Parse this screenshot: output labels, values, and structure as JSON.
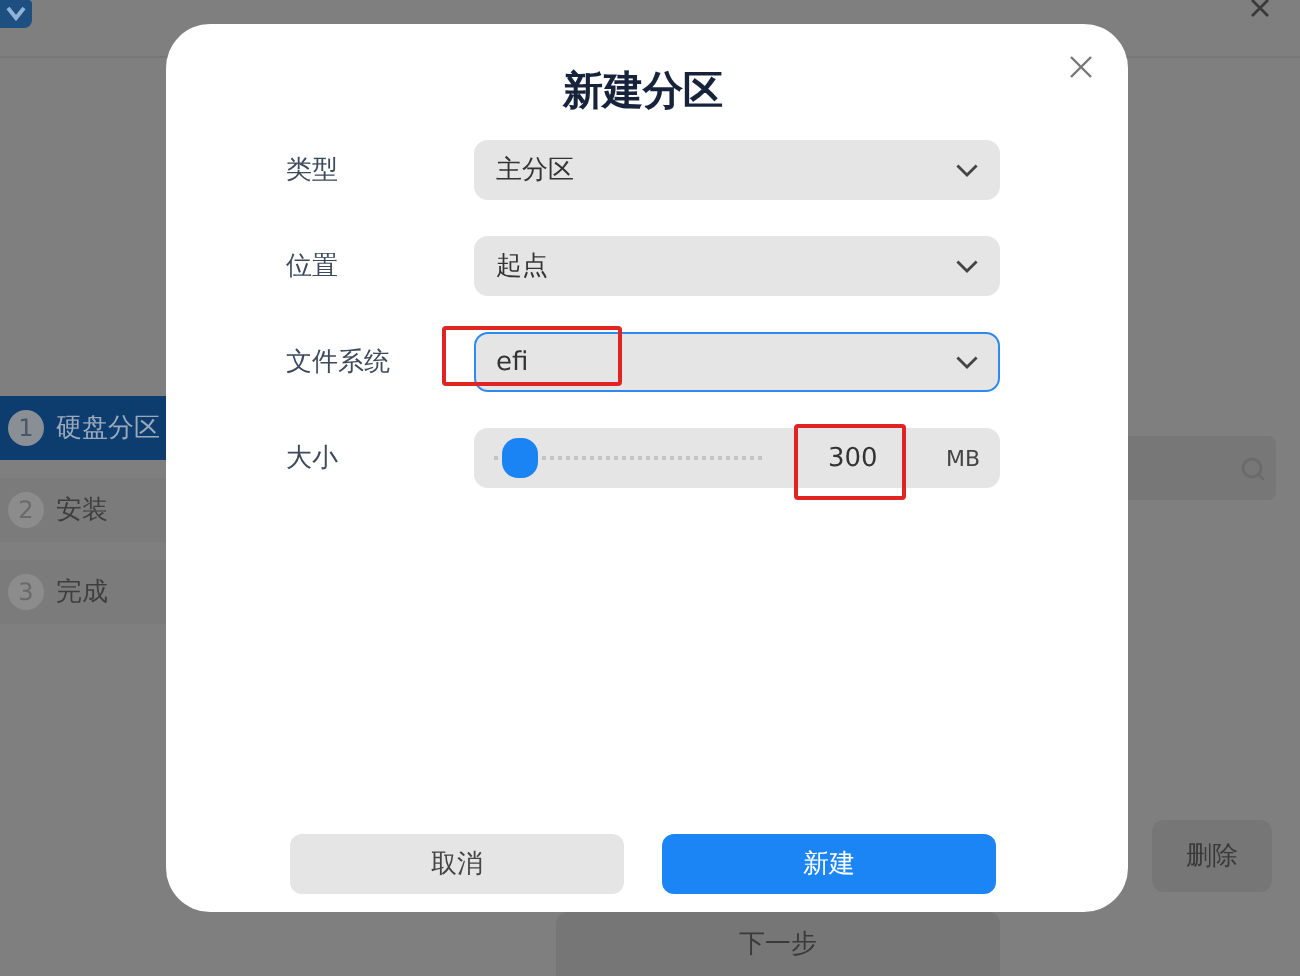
{
  "app": {
    "steps": [
      {
        "number": "1",
        "label": "硬盘分区",
        "selected": true
      },
      {
        "number": "2",
        "label": "安装",
        "selected": false
      },
      {
        "number": "3",
        "label": "完成",
        "selected": false
      }
    ],
    "buttons": [
      {
        "label": "删除",
        "kind": "side"
      },
      {
        "label": "下一步",
        "kind": "next"
      }
    ]
  },
  "dialog": {
    "title": "新建分区",
    "fields": [
      {
        "kind": "select",
        "label": "类型",
        "value": "主分区",
        "focused": false,
        "highlighted": false
      },
      {
        "kind": "select",
        "label": "位置",
        "value": "起点",
        "focused": false,
        "highlighted": false
      },
      {
        "kind": "select",
        "label": "文件系统",
        "value": "efi",
        "focused": true,
        "highlighted": true
      },
      {
        "kind": "slider",
        "label": "大小",
        "level": 0.03,
        "value": "300",
        "unit": "MB",
        "highlighted": true
      }
    ],
    "buttons": [
      {
        "label": "取消",
        "kind": "secondary"
      },
      {
        "label": "新建",
        "kind": "primary"
      }
    ]
  }
}
